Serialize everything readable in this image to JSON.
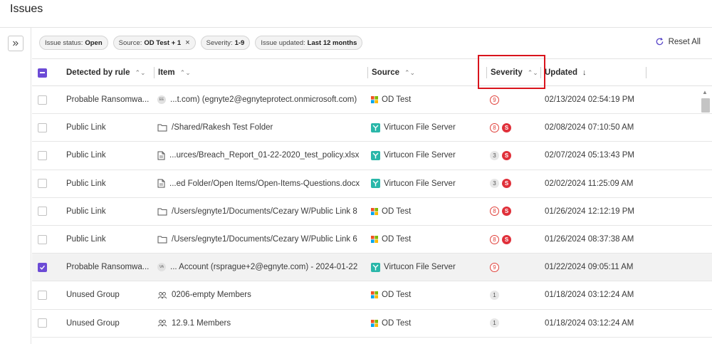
{
  "page": {
    "title": "Issues"
  },
  "filters": [
    {
      "label": "Issue status:",
      "value": "Open",
      "removable": false
    },
    {
      "label": "Source:",
      "value": "OD Test + 1",
      "removable": true
    },
    {
      "label": "Severity:",
      "value": "1-9",
      "removable": false
    },
    {
      "label": "Issue updated:",
      "value": "Last 12 months",
      "removable": false
    }
  ],
  "reset_label": "Reset All",
  "columns": {
    "rule": "Detected by rule",
    "item": "Item",
    "source": "Source",
    "severity": "Severity",
    "updated": "Updated"
  },
  "rows": [
    {
      "rule": "Probable Ransomwa...",
      "item_icon": "avatar",
      "avatar": "EE",
      "item": "...t.com) (egnyte2@egnyteprotect.onmicrosoft.com)",
      "source": "OD Test",
      "source_icon": "windows-icon",
      "severity": "9",
      "sev_style": "high",
      "sensitive": "",
      "updated": "02/13/2024 02:54:19 PM",
      "selected": false
    },
    {
      "rule": "Public Link",
      "item_icon": "folder",
      "avatar": "",
      "item": "/Shared/Rakesh Test Folder",
      "source": "Virtucon File Server",
      "source_icon": "server-icon",
      "severity": "8",
      "sev_style": "high",
      "sensitive": "S",
      "updated": "02/08/2024 07:10:50 AM",
      "selected": false
    },
    {
      "rule": "Public Link",
      "item_icon": "file",
      "avatar": "",
      "item": "...urces/Breach_Report_01-22-2020_test_policy.xlsx",
      "source": "Virtucon File Server",
      "source_icon": "server-icon",
      "severity": "3",
      "sev_style": "low",
      "sensitive": "S",
      "updated": "02/07/2024 05:13:43 PM",
      "selected": false
    },
    {
      "rule": "Public Link",
      "item_icon": "file",
      "avatar": "",
      "item": "...ed Folder/Open Items/Open-Items-Questions.docx",
      "source": "Virtucon File Server",
      "source_icon": "server-icon",
      "severity": "3",
      "sev_style": "low",
      "sensitive": "S",
      "updated": "02/02/2024 11:25:09 AM",
      "selected": false
    },
    {
      "rule": "Public Link",
      "item_icon": "folder",
      "avatar": "",
      "item": "/Users/egnyte1/Documents/Cezary W/Public Link 8",
      "source": "OD Test",
      "source_icon": "windows-icon",
      "severity": "8",
      "sev_style": "high",
      "sensitive": "S",
      "updated": "01/26/2024 12:12:19 PM",
      "selected": false
    },
    {
      "rule": "Public Link",
      "item_icon": "folder",
      "avatar": "",
      "item": "/Users/egnyte1/Documents/Cezary W/Public Link 6",
      "source": "OD Test",
      "source_icon": "windows-icon",
      "severity": "8",
      "sev_style": "high",
      "sensitive": "S",
      "updated": "01/26/2024 08:37:38 AM",
      "selected": false
    },
    {
      "rule": "Probable Ransomwa...",
      "item_icon": "avatar",
      "avatar": "VA",
      "item": "... Account (rsprague+2@egnyte.com) - 2024-01-22",
      "source": "Virtucon File Server",
      "source_icon": "server-icon",
      "severity": "9",
      "sev_style": "high",
      "sensitive": "",
      "updated": "01/22/2024 09:05:11 AM",
      "selected": true
    },
    {
      "rule": "Unused Group",
      "item_icon": "group",
      "avatar": "",
      "item": "0206-empty Members",
      "source": "OD Test",
      "source_icon": "windows-icon",
      "severity": "1",
      "sev_style": "low",
      "sensitive": "",
      "updated": "01/18/2024 03:12:24 AM",
      "selected": false
    },
    {
      "rule": "Unused Group",
      "item_icon": "group",
      "avatar": "",
      "item": "12.9.1 Members",
      "source": "OD Test",
      "source_icon": "windows-icon",
      "severity": "1",
      "sev_style": "low",
      "sensitive": "",
      "updated": "01/18/2024 03:12:24 AM",
      "selected": false
    }
  ],
  "colors": {
    "accent": "#6c4bd6",
    "severity_high": "#e0403a",
    "highlight_box": "#d9141c",
    "server_teal": "#2ab7a9"
  }
}
